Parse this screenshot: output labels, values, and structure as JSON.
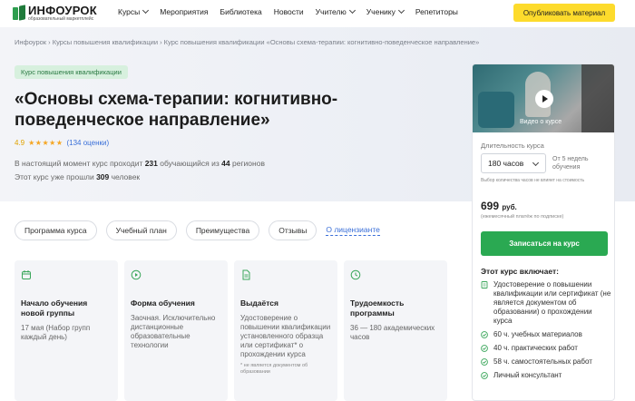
{
  "header": {
    "logo_name": "ИНФОУРОК",
    "logo_sub": "образовательный маркетплейс",
    "nav": [
      {
        "label": "Курсы",
        "dropdown": true
      },
      {
        "label": "Мероприятия",
        "dropdown": false
      },
      {
        "label": "Библиотека",
        "dropdown": false
      },
      {
        "label": "Новости",
        "dropdown": false
      },
      {
        "label": "Учителю",
        "dropdown": true
      },
      {
        "label": "Ученику",
        "dropdown": true
      },
      {
        "label": "Репетиторы",
        "dropdown": false
      }
    ],
    "publish_button": "Опубликовать материал"
  },
  "breadcrumb": "Инфоурок › Курсы повышения квалификации › Курс повышения квалификации «Основы схема-терапии: когнитивно-поведенческое направление»",
  "course": {
    "badge": "Курс повышения квалификации",
    "title": "«Основы схема-терапии: когнитивно-поведенческое направление»",
    "rating_value": "4.9",
    "stars": "★★★★★",
    "rating_count": "(134 оценки)",
    "stat1_pre": "В настоящий момент курс проходит ",
    "stat1_num1": "231",
    "stat1_mid": " обучающийся из ",
    "stat1_num2": "44",
    "stat1_post": " регионов",
    "stat2_pre": "Этот курс уже прошли ",
    "stat2_num": "309",
    "stat2_post": " человек"
  },
  "tabs": [
    "Программа курса",
    "Учебный план",
    "Преимущества",
    "Отзывы"
  ],
  "tab_link": "О лицензианте",
  "cards": [
    {
      "icon": "calendar-icon",
      "title": "Начало обучения новой группы",
      "text": "17 мая (Набор групп каждый день)",
      "note": ""
    },
    {
      "icon": "play-circle-icon",
      "title": "Форма обучения",
      "text": "Заочная. Исключительно дистанционные образовательные технологии",
      "note": ""
    },
    {
      "icon": "document-icon",
      "title": "Выдаётся",
      "text": "Удостоверение о повышении квалификации установленного образца или сертификат* о прохождении курса",
      "note": "* не является документом об образовании"
    },
    {
      "icon": "clock-icon",
      "title": "Трудоемкость программы",
      "text": "36 — 180 академических часов",
      "note": ""
    }
  ],
  "panel": {
    "video_label": "Видео о курсе",
    "duration_label": "Длительность курса",
    "hours_selected": "180 часов",
    "duration_text": "От 5 недель обучения",
    "price_note": "Выбор количества часов не влияет на стоимость",
    "price": "699",
    "price_currency": "руб.",
    "price_sub": "(ежемесячный платёж по подписке)",
    "enroll_button": "Записаться на курс",
    "includes_title": "Этот курс включает:",
    "includes": [
      {
        "icon": "certificate-icon",
        "text": "Удостоверение о повышении квалификации или сертификат (не является документом об образовании) о прохождении курса"
      },
      {
        "icon": "check-circle-icon",
        "text": "60 ч. учебных материалов"
      },
      {
        "icon": "check-circle-icon",
        "text": "40 ч. практических работ"
      },
      {
        "icon": "check-circle-icon",
        "text": "58 ч. самостоятельных работ"
      },
      {
        "icon": "check-circle-icon",
        "text": "Личный консультант"
      }
    ]
  },
  "colors": {
    "accent_green": "#2aa952",
    "accent_yellow": "#fddb2c",
    "link_blue": "#3a6fd8",
    "icon_green": "#3aa65a"
  }
}
